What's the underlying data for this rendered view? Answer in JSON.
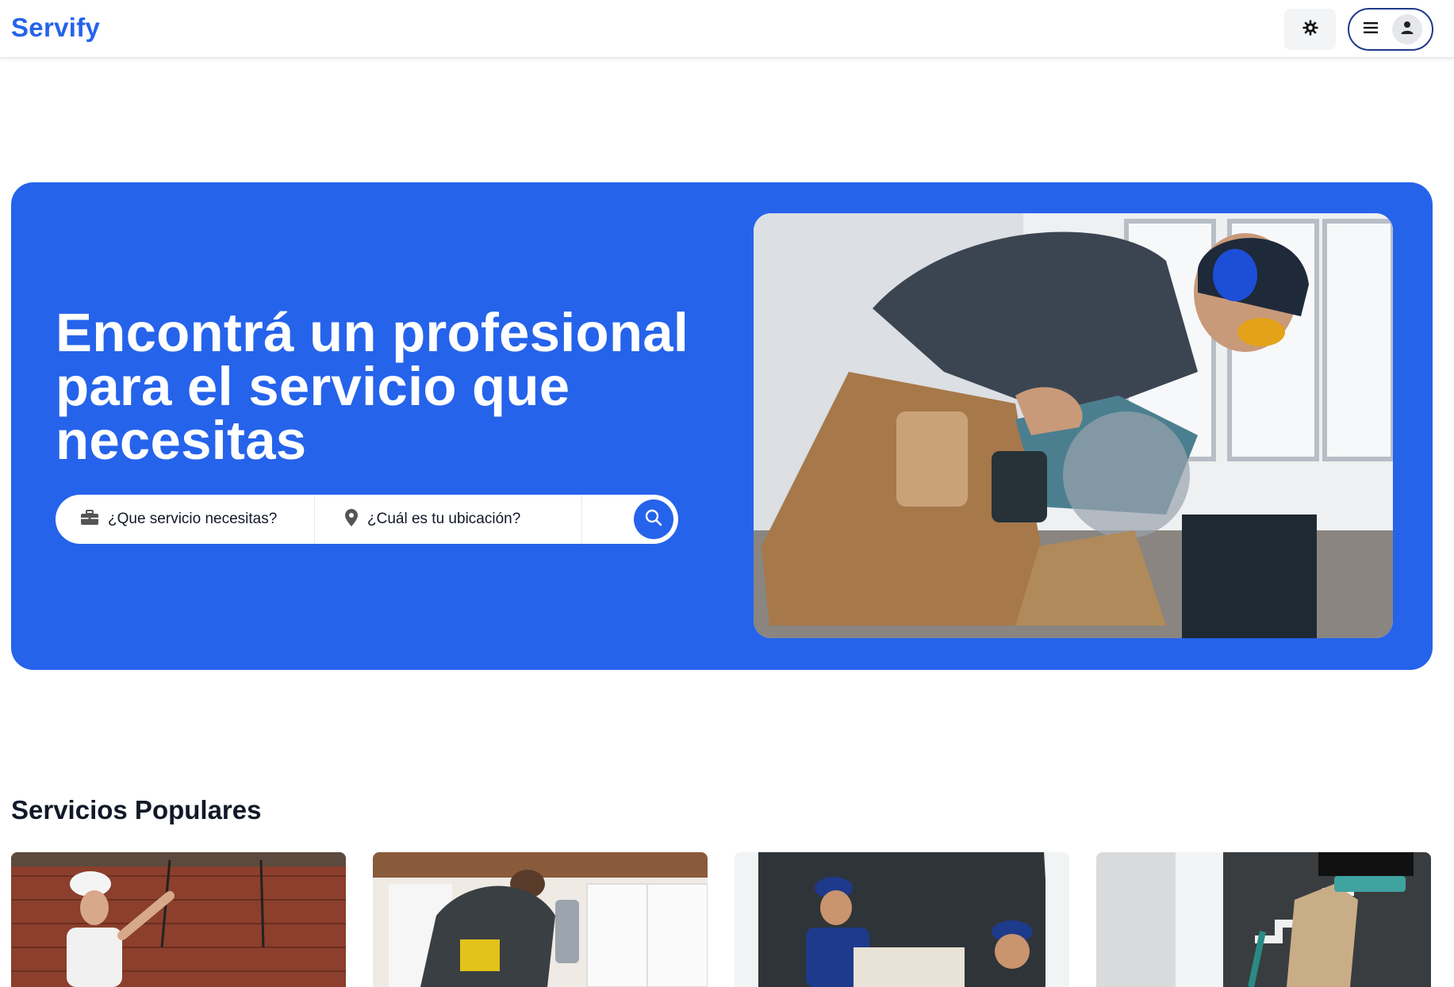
{
  "header": {
    "logo": "Servify",
    "icons": {
      "theme": "gear-icon",
      "menu": "hamburger-menu-icon",
      "user": "user-icon"
    }
  },
  "hero": {
    "title": "Encontrá un profesional para el servicio que necesitas",
    "search": {
      "service_placeholder": "¿Que servicio necesitas?",
      "location_placeholder": "¿Cuál es tu ubicación?",
      "icons": {
        "service": "briefcase-icon",
        "location": "map-pin-icon",
        "submit": "search-icon"
      }
    },
    "image": "carpenter-with-circular-saw-photo"
  },
  "popular": {
    "title": "Servicios Populares",
    "cards": [
      {
        "image": "electrician-photo"
      },
      {
        "image": "plumber-photo"
      },
      {
        "image": "movers-photo"
      },
      {
        "image": "cleaner-photo"
      }
    ]
  },
  "colors": {
    "brand": "#2563eb",
    "menu_border": "#1e3a8a"
  }
}
